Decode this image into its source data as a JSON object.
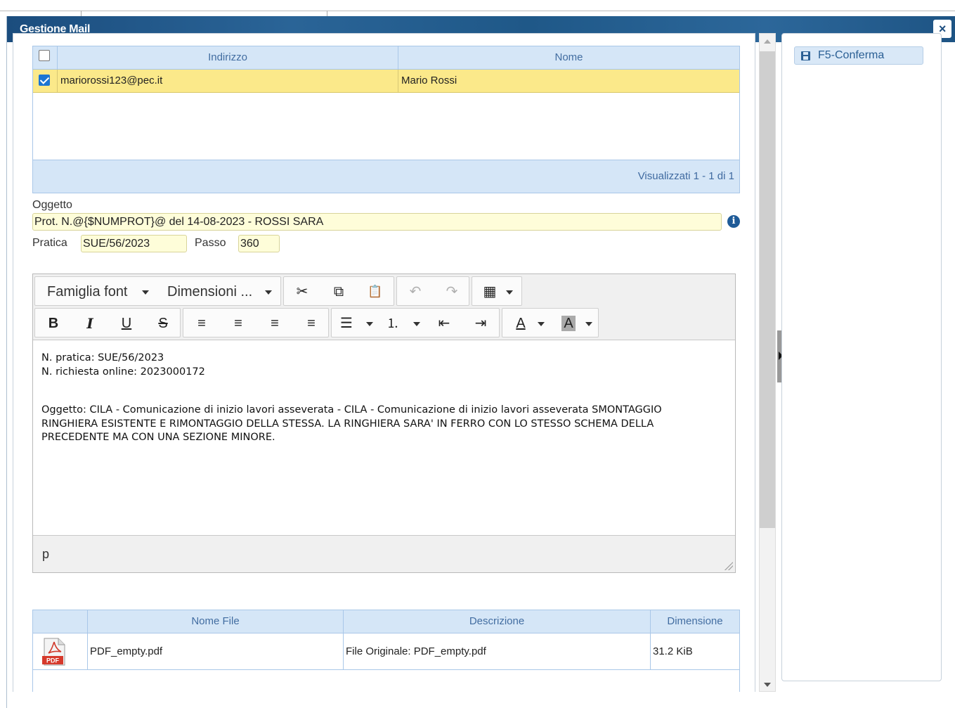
{
  "dialog": {
    "title": "Gestione Mail",
    "close_label": "×"
  },
  "side": {
    "confirm_label": "F5-Conferma"
  },
  "recipients": {
    "columns": [
      "",
      "Indirizzo",
      "Nome"
    ],
    "rows": [
      {
        "checked": true,
        "address": "mariorossi123@pec.it",
        "name": "Mario Rossi"
      }
    ],
    "footer": "Visualizzati 1 - 1 di 1"
  },
  "form": {
    "subject_label": "Oggetto",
    "subject_value": "Prot. N.@{$NUMPROT}@ del 14-08-2023 - ROSSI SARA",
    "info_icon": "i",
    "practice_label": "Pratica",
    "practice_value": "SUE/56/2023",
    "step_label": "Passo",
    "step_value": "360"
  },
  "editor": {
    "font_family_label": "Famiglia font",
    "font_size_label": "Dimensioni ...",
    "body_lines": [
      "N. pratica: SUE/56/2023",
      "N. richiesta online: 2023000172",
      "",
      "",
      "Oggetto: CILA - Comunicazione di inizio lavori asseverata - CILA - Comunicazione di inizio lavori asseverata SMONTAGGIO",
      "RINGHIERA ESISTENTE E RIMONTAGGIO DELLA STESSA. LA RINGHIERA SARA' IN FERRO CON LO STESSO SCHEMA DELLA",
      "PRECEDENTE MA CON UNA SEZIONE MINORE."
    ],
    "status_path": "p",
    "toolbar_icons": {
      "cut": "✂",
      "copy": "⧉",
      "paste": "📋",
      "undo": "↶",
      "redo": "↷",
      "table": "▦",
      "bold": "B",
      "italic": "I",
      "underline": "U",
      "strike": "S",
      "align_left": "≡",
      "align_center": "≡",
      "align_right": "≡",
      "justify": "≡",
      "bullet_list": "☰",
      "numbered_list": "⒈",
      "outdent": "⇤",
      "indent": "⇥",
      "font_color": "A",
      "bg_color": "A"
    }
  },
  "files": {
    "columns": [
      "",
      "Nome File",
      "Descrizione",
      "Dimensione"
    ],
    "rows": [
      {
        "icon": "pdf-icon",
        "pdf_label": "PDF",
        "filename": "PDF_empty.pdf",
        "description": "File Originale: PDF_empty.pdf",
        "size": "31.2 KiB"
      }
    ]
  },
  "colors": {
    "titlebar": "#1e5484",
    "selected_row": "#fbe98a",
    "grid_header": "#d5e6f7",
    "input_bg": "#fefdd9"
  }
}
